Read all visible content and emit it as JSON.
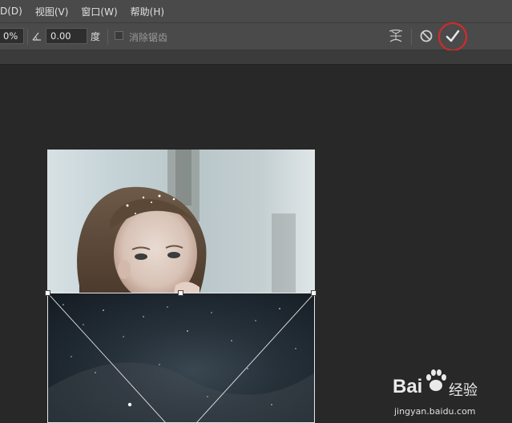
{
  "menu": {
    "items": [
      "D(D)",
      "视图(V)",
      "窗口(W)",
      "帮助(H)"
    ]
  },
  "options": {
    "scale_value": "0%",
    "rotate_value": "0.00",
    "rotate_unit": "度",
    "antialias_label": "消除锯齿",
    "antialias_checked": false
  },
  "watermark": {
    "brand": "Bai",
    "brand_cn": "经验",
    "url": "jingyan.baidu.com"
  },
  "colors": {
    "highlight_circle": "#d42a2a",
    "commit_check": "#e6e6e6"
  },
  "icons": [
    "warp-icon",
    "cancel-icon",
    "commit-check-icon",
    "rotate-angle-icon",
    "paw-icon"
  ]
}
